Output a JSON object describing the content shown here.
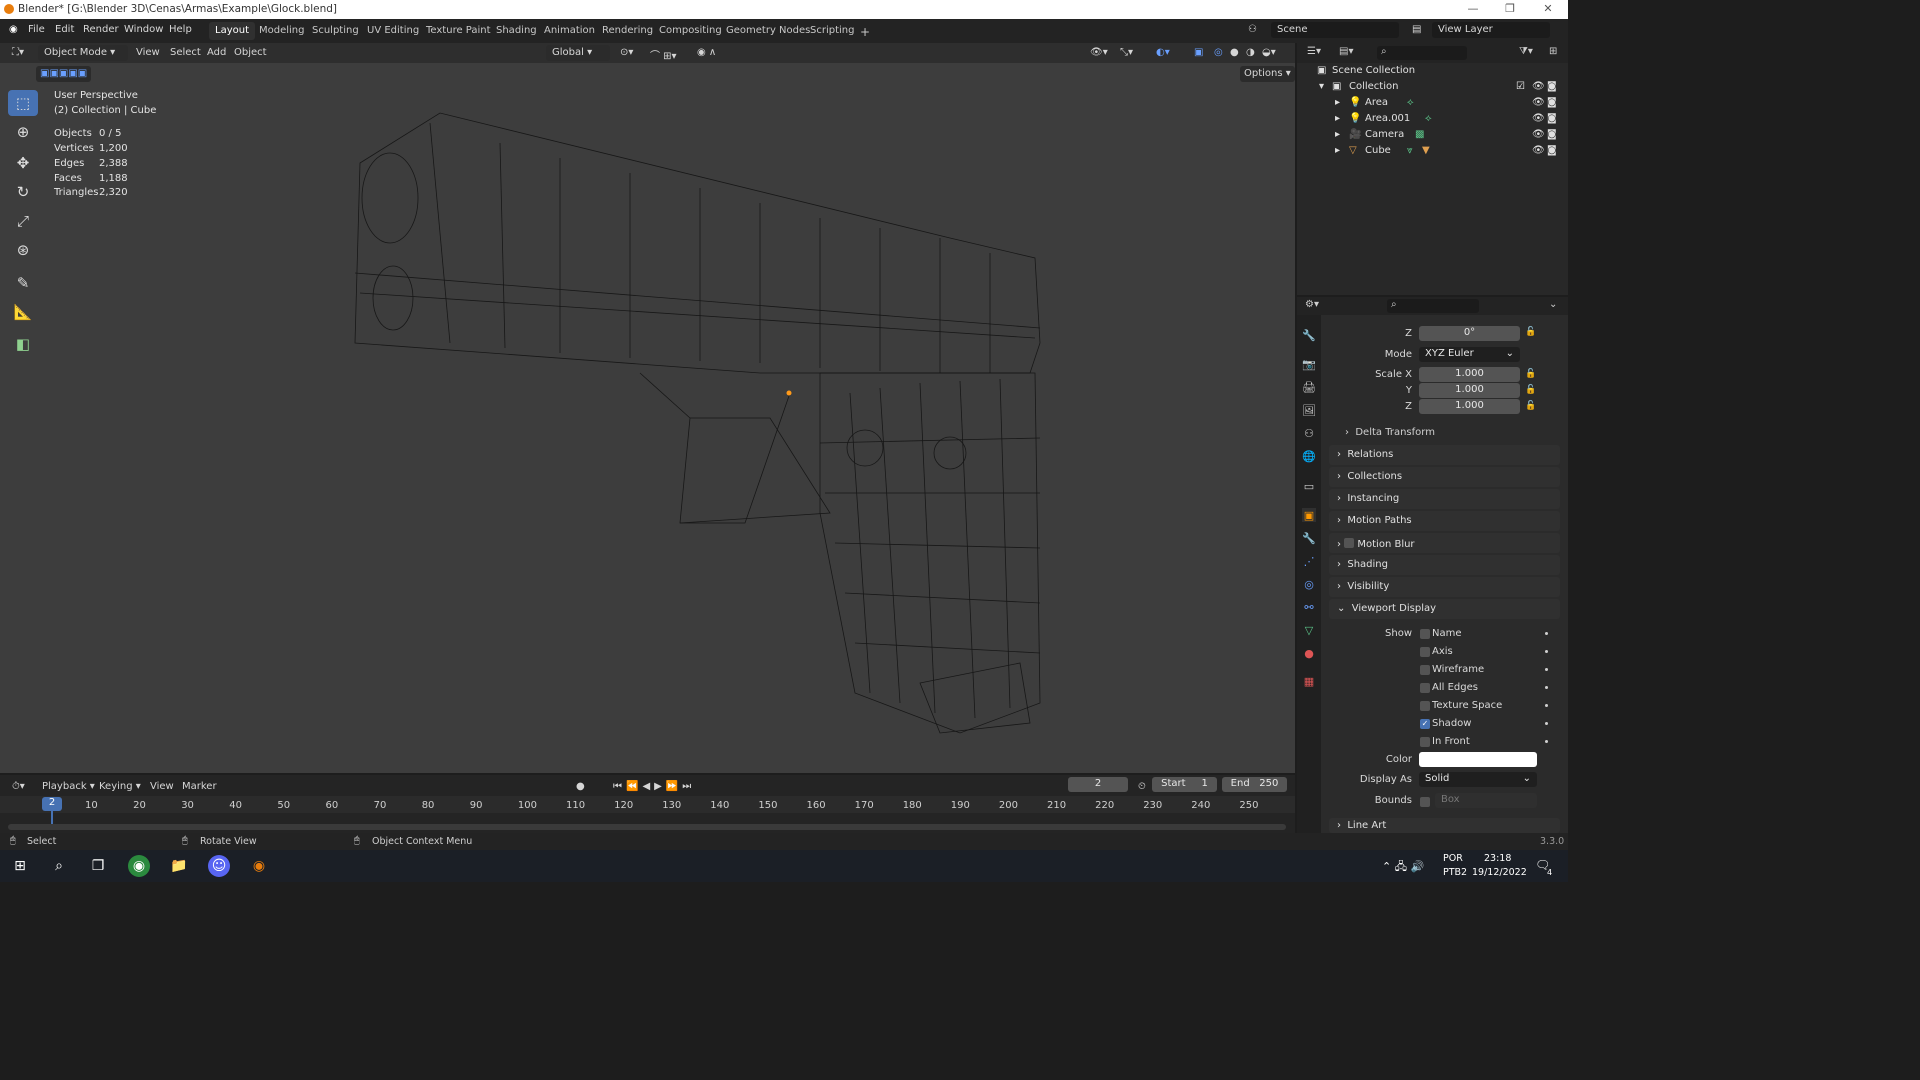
{
  "window": {
    "title": "Blender* [G:\\Blender 3D\\Cenas\\Armas\\Example\\Glock.blend]"
  },
  "menu": [
    "File",
    "Edit",
    "Render",
    "Window",
    "Help"
  ],
  "workspaces": [
    "Layout",
    "Modeling",
    "Sculpting",
    "UV Editing",
    "Texture Paint",
    "Shading",
    "Animation",
    "Rendering",
    "Compositing",
    "Geometry Nodes",
    "Scripting"
  ],
  "scene": "Scene",
  "view_layer": "View Layer",
  "viewport": {
    "mode": "Object Mode",
    "menus": [
      "View",
      "Select",
      "Add",
      "Object"
    ],
    "orientation": "Global",
    "options": "Options",
    "overlay_title": "User Perspective",
    "overlay_sub": "(2) Collection | Cube",
    "stats": [
      [
        "Objects",
        "0 / 5"
      ],
      [
        "Vertices",
        "1,200"
      ],
      [
        "Edges",
        "2,388"
      ],
      [
        "Faces",
        "1,188"
      ],
      [
        "Triangles",
        "2,320"
      ]
    ]
  },
  "outliner": {
    "root": "Scene Collection",
    "collection": "Collection",
    "items": [
      "Area",
      "Area.001",
      "Camera",
      "Cube"
    ]
  },
  "properties": {
    "rot_z": "0°",
    "mode_label": "Mode",
    "mode": "XYZ Euler",
    "scale_label": "Scale X",
    "scale": [
      "1.000",
      "1.000",
      "1.000"
    ],
    "axis_y": "Y",
    "axis_z": "Z",
    "panels": [
      "Delta Transform",
      "Relations",
      "Collections",
      "Instancing",
      "Motion Paths",
      "Motion Blur",
      "Shading",
      "Visibility"
    ],
    "viewport_display": "Viewport Display",
    "show_label": "Show",
    "show": [
      {
        "label": "Name",
        "on": false
      },
      {
        "label": "Axis",
        "on": false
      },
      {
        "label": "Wireframe",
        "on": false
      },
      {
        "label": "All Edges",
        "on": false
      },
      {
        "label": "Texture Space",
        "on": false
      },
      {
        "label": "Shadow",
        "on": true
      },
      {
        "label": "In Front",
        "on": false
      }
    ],
    "color_label": "Color",
    "display_as_label": "Display As",
    "display_as": "Solid",
    "bounds_label": "Bounds",
    "bounds": "Box",
    "line_art": "Line Art"
  },
  "timeline": {
    "menus": [
      "Playback",
      "Keying",
      "View",
      "Marker"
    ],
    "current": "2",
    "start_label": "Start",
    "start": "1",
    "end_label": "End",
    "end": "250",
    "ticks": [
      "10",
      "20",
      "30",
      "40",
      "50",
      "60",
      "70",
      "80",
      "90",
      "100",
      "110",
      "120",
      "130",
      "140",
      "150",
      "160",
      "170",
      "180",
      "190",
      "200",
      "210",
      "220",
      "230",
      "240",
      "250"
    ]
  },
  "status": {
    "select": "Select",
    "rotate": "Rotate View",
    "context": "Object Context Menu",
    "version": "3.3.0"
  },
  "taskbar": {
    "lang1": "POR",
    "lang2": "PTB2",
    "time": "23:18",
    "date": "19/12/2022",
    "notif": "4"
  }
}
